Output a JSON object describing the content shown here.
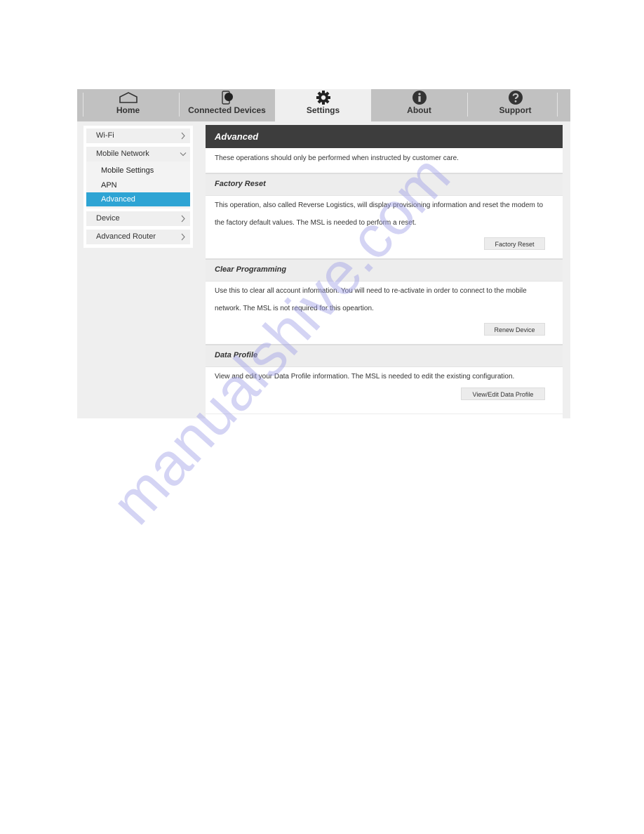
{
  "topnav": {
    "tabs": [
      {
        "label": "Home",
        "icon": "home-icon",
        "active": false
      },
      {
        "label": "Connected Devices",
        "icon": "connected-devices-icon",
        "active": false
      },
      {
        "label": "Settings",
        "icon": "gear-icon",
        "active": true
      },
      {
        "label": "About",
        "icon": "info-icon",
        "active": false
      },
      {
        "label": "Support",
        "icon": "question-icon",
        "active": false
      }
    ]
  },
  "sidebar": {
    "wifi": "Wi-Fi",
    "mobile_network": {
      "label": "Mobile Network",
      "items": [
        "Mobile Settings",
        "APN",
        "Advanced"
      ],
      "active": "Advanced"
    },
    "device": "Device",
    "advanced_router": "Advanced Router"
  },
  "main": {
    "title": "Advanced",
    "intro": "These operations should only be performed when instructed by customer care.",
    "sections": [
      {
        "title": "Factory Reset",
        "text_line1": "This operation, also called Reverse Logistics, will display provisioning information and reset the modem to",
        "text_line2": "the factory default values. The MSL is needed to perform a reset.",
        "button": "Factory Reset"
      },
      {
        "title": "Clear Programming",
        "text_line1": "Use this to clear all account information. You will need to re-activate in order to connect to the mobile",
        "text_line2": "network. The MSL is not required for this opeartion.",
        "button": "Renew Device"
      },
      {
        "title": "Data Profile",
        "text_line1": "View and edit your Data Profile information. The MSL is needed to edit the existing configuration.",
        "button": "View/Edit Data Profile"
      }
    ]
  },
  "watermark": "manualshive.com",
  "colors": {
    "nav_bg": "#c1c1c1",
    "active_tab_bg": "#efefef",
    "sidebar_active": "#2ea4d4",
    "title_bar": "#3d3d3d"
  }
}
